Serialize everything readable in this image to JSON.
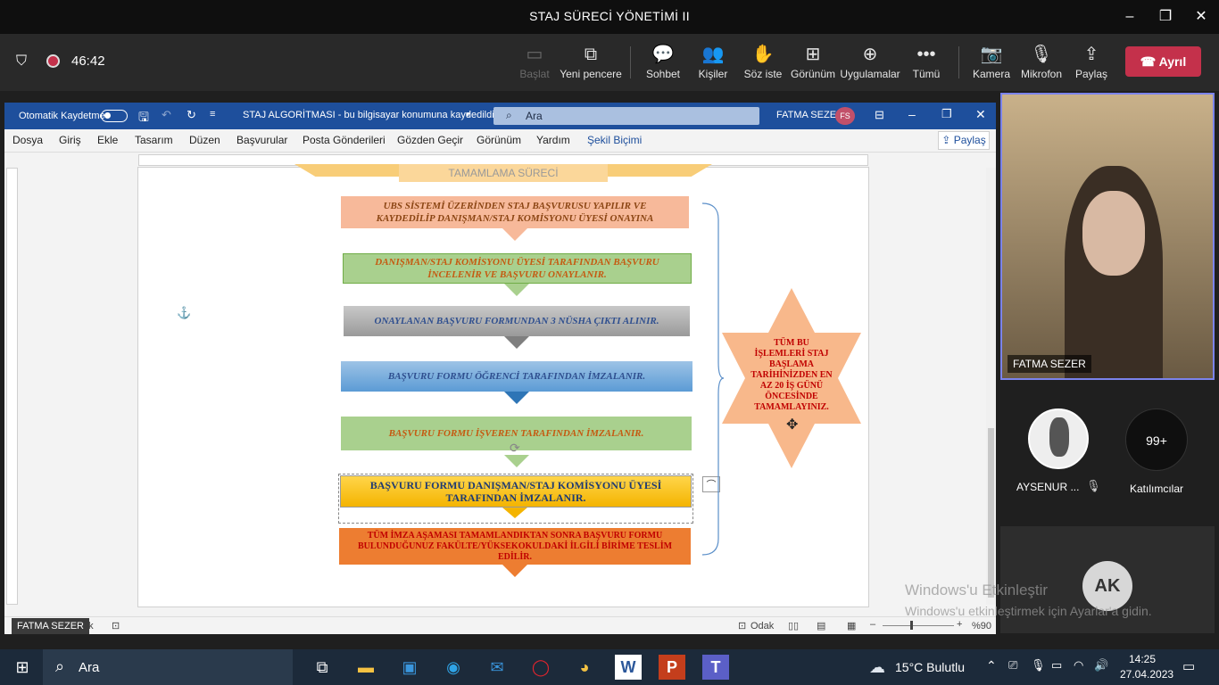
{
  "window": {
    "title": "STAJ SÜRECİ YÖNETİMİ II"
  },
  "meeting": {
    "timer": "46:42",
    "tools": [
      {
        "label": "Başlat",
        "icon": "monitor-icon"
      },
      {
        "label": "Yeni pencere",
        "icon": "new-window-icon"
      },
      {
        "label": "Sohbet",
        "icon": "chat-icon"
      },
      {
        "label": "Kişiler",
        "icon": "people-icon"
      },
      {
        "label": "Söz iste",
        "icon": "raise-hand-icon"
      },
      {
        "label": "Görünüm",
        "icon": "grid-icon"
      },
      {
        "label": "Uygulamalar",
        "icon": "apps-icon"
      },
      {
        "label": "Tümü",
        "icon": "more-icon"
      },
      {
        "label": "Kamera",
        "icon": "camera-off-icon"
      },
      {
        "label": "Mikrofon",
        "icon": "mic-off-icon"
      },
      {
        "label": "Paylaş",
        "icon": "share-icon"
      }
    ],
    "leave_label": "Ayrıl",
    "leave_color": "#c4314b"
  },
  "word": {
    "autosave_label": "Otomatik Kaydetme",
    "doc_title": "STAJ ALGORİTMASI  -  bu bilgisayar konumuna kaydedildi",
    "search_placeholder": "Ara",
    "user_name": "FATMA SEZER",
    "user_initials": "FS",
    "share_label": "Paylaş",
    "menu": [
      "Dosya",
      "Giriş",
      "Ekle",
      "Tasarım",
      "Düzen",
      "Başvurular",
      "Posta Gönderileri",
      "Gözden Geçir",
      "Görünüm",
      "Yardım",
      "Şekil Biçimi"
    ],
    "status": {
      "focus_label": "Odak",
      "zoom": "%90",
      "page_hint": "ük"
    },
    "flow": {
      "top_label": "TAMAMLAMA SÜRECİ",
      "steps": [
        "UBS SİSTEMİ ÜZERİNDEN STAJ BAŞVURUSU YAPILIR VE KAYDEDİLİP DANIŞMAN/STAJ KOMİSYONU ÜYESİ ONAYINA",
        "DANIŞMAN/STAJ KOMİSYONU ÜYESİ TARAFINDAN BAŞVURU İNCELENİR VE BAŞVURU ONAYLANIR.",
        "ONAYLANAN BAŞVURU FORMUNDAN 3 NÜSHA ÇIKTI ALINIR.",
        "BAŞVURU FORMU ÖĞRENCİ TARAFINDAN İMZALANIR.",
        "BAŞVURU FORMU İŞVEREN TARAFINDAN İMZALANIR.",
        "BAŞVURU FORMU DANIŞMAN/STAJ KOMİSYONU ÜYESİ TARAFINDAN İMZALANIR.",
        "TÜM İMZA AŞAMASI TAMAMLANDIKTAN SONRA BAŞVURU FORMU BULUNDUĞUNUZ FAKÜLTE/YÜKSEKOKULDAKİ İLGİLİ BİRİME TESLİM EDİLİR."
      ],
      "star_text": "TÜM BU İŞLEMLERİ STAJ BAŞLAMA TARİHİNİZDEN EN AZ 20 İŞ GÜNÜ ÖNCESİNDE TAMAMLAYINIZ."
    }
  },
  "participants": {
    "main_name": "FATMA SEZER",
    "presenter_tag": "FATMA SEZER",
    "second_name": "AYSENUR ...",
    "more_count": "99+",
    "more_label": "Katılımcılar",
    "ak_initials": "AK"
  },
  "watermark": {
    "line1": "Windows'u Etkinleştir",
    "line2": "Windows'u etkinleştirmek için Ayarlar'a gidin."
  },
  "taskbar": {
    "search_label": "Ara",
    "weather": "15°C  Bulutlu",
    "time": "14:25",
    "date": "27.04.2023"
  }
}
